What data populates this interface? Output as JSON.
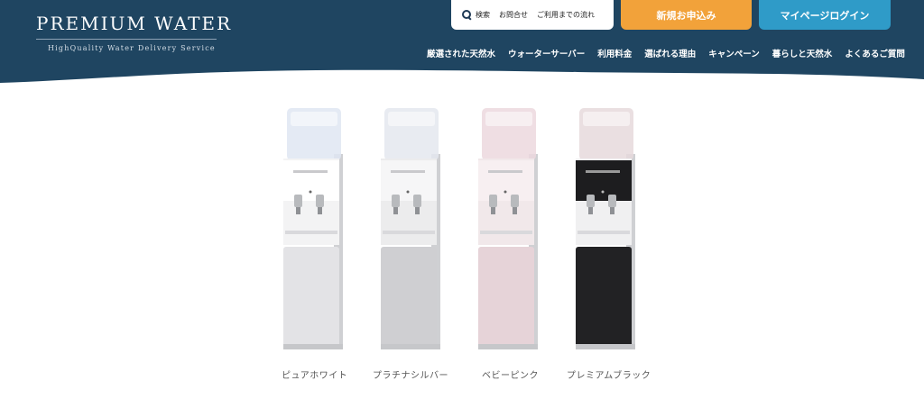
{
  "brand": {
    "name": "PREMIUM WATER",
    "tagline": "HighQuality  Water  Delivery  Service"
  },
  "utility": {
    "search_label": "検索",
    "contact_label": "お問合せ",
    "flow_label": "ご利用までの流れ"
  },
  "cta": {
    "signup_label": "新規お申込み",
    "mypage_label": "マイページログイン"
  },
  "nav": {
    "items": [
      {
        "label": "厳選された天然水"
      },
      {
        "label": "ウォーターサーバー"
      },
      {
        "label": "利用料金"
      },
      {
        "label": "選ばれる理由"
      },
      {
        "label": "キャンペーン"
      },
      {
        "label": "暮らしと天然水"
      },
      {
        "label": "よくあるご質問"
      }
    ]
  },
  "colors": {
    "header_bg": "#1f4561",
    "signup_bg": "#f2a23a",
    "mypage_bg": "#2f9bc8"
  },
  "products": [
    {
      "name": "ピュアホワイト",
      "color": "pure-white",
      "body": "#f3f3f4",
      "shade": "#e3e3e6",
      "panel": "#ffffff",
      "tank": "#dfe6f2"
    },
    {
      "name": "プラチナシルバー",
      "color": "platinum-silver",
      "body": "#ececed",
      "shade": "#cfcfd2",
      "panel": "#f6f6f7",
      "tank": "#e4e8ee"
    },
    {
      "name": "ベビーピンク",
      "color": "baby-pink",
      "body": "#f1e8ea",
      "shade": "#e6d3d8",
      "panel": "#f7eff1",
      "tank": "#ecd8de"
    },
    {
      "name": "プレミアムブラック",
      "color": "premium-black",
      "body": "#f0f0f1",
      "shade": "#222224",
      "panel": "#2a2a2c",
      "tank": "#e6d9dc"
    }
  ]
}
